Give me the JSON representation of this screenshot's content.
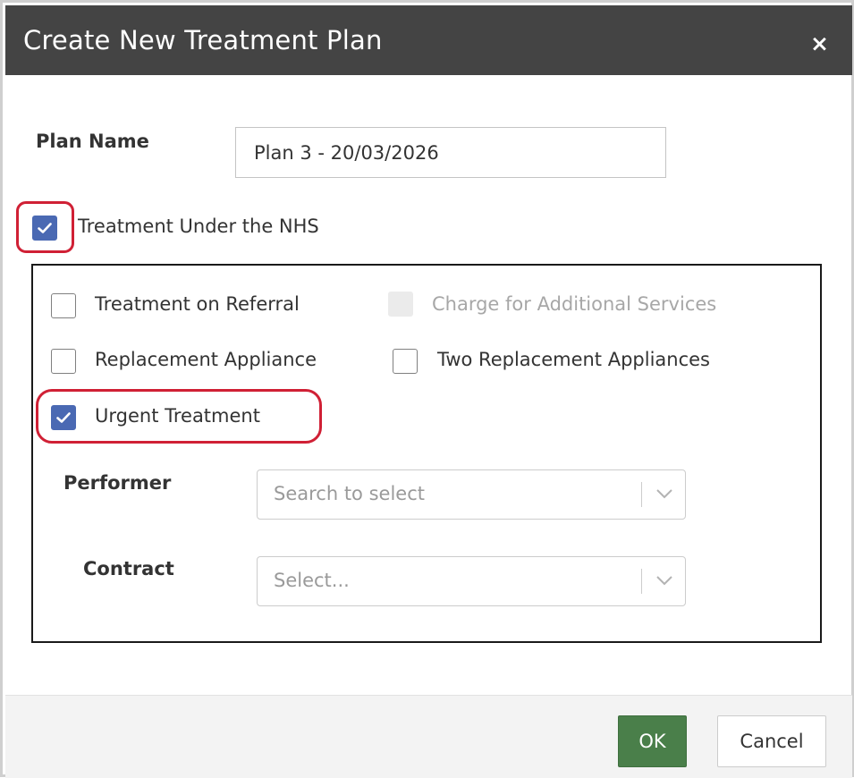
{
  "dialog": {
    "title": "Create New Treatment Plan",
    "close_label": "×"
  },
  "plan_name": {
    "label": "Plan Name",
    "value": "Plan 3 - 20/03/2026"
  },
  "nhs": {
    "label": "Treatment Under the NHS",
    "checked": true
  },
  "options": {
    "referral": {
      "label": "Treatment on Referral",
      "checked": false
    },
    "charge": {
      "label": "Charge for Additional Services",
      "checked": false,
      "disabled": true
    },
    "replacement": {
      "label": "Replacement Appliance",
      "checked": false
    },
    "two_replacement": {
      "label": "Two Replacement Appliances",
      "checked": false
    },
    "urgent": {
      "label": "Urgent Treatment",
      "checked": true
    }
  },
  "performer": {
    "label": "Performer",
    "placeholder": "Search to select"
  },
  "contract": {
    "label": "Contract",
    "placeholder": "Select..."
  },
  "footer": {
    "ok_label": "OK",
    "cancel_label": "Cancel"
  },
  "colors": {
    "titlebar": "#444444",
    "checkbox_checked": "#4a69b3",
    "highlight": "#d02035",
    "ok_button": "#4a7f4a"
  }
}
